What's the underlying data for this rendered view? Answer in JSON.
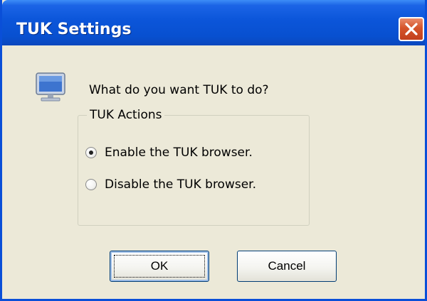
{
  "window": {
    "title": "TUK Settings"
  },
  "prompt": "What do you want TUK to do?",
  "group": {
    "label": "TUK Actions",
    "options": [
      {
        "label": "Enable the TUK browser.",
        "selected": true
      },
      {
        "label": "Disable the TUK browser.",
        "selected": false
      }
    ]
  },
  "buttons": {
    "ok_label": "OK",
    "cancel_label": "Cancel"
  },
  "icons": {
    "title_close": "close-icon",
    "dialog_icon": "monitor-icon"
  },
  "colors": {
    "titlebar": "#0850d0",
    "close_button": "#d5542a",
    "dialog_background": "#ece9d8"
  }
}
